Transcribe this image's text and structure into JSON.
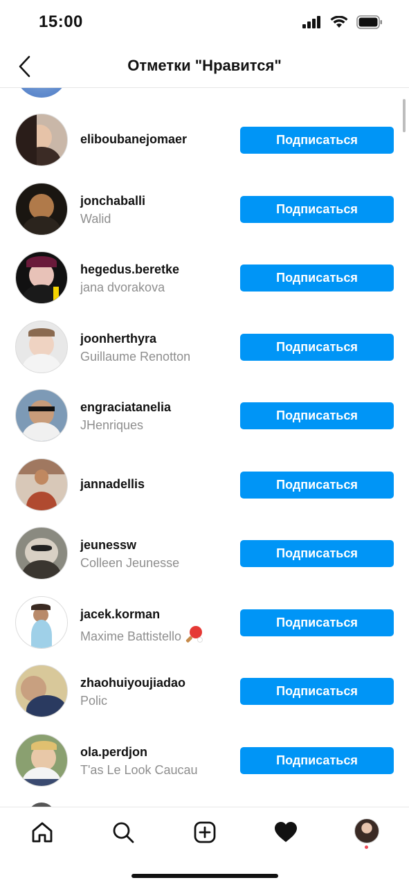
{
  "status_bar": {
    "time": "15:00"
  },
  "header": {
    "title": "Отметки \"Нравится\""
  },
  "users": [
    {
      "username": "eliboubanejomaer",
      "full_name": "",
      "button": "Подписаться"
    },
    {
      "username": "jonchaballi",
      "full_name": "Walid",
      "button": "Подписаться"
    },
    {
      "username": "hegedus.beretke",
      "full_name": "jana dvorakova",
      "button": "Подписаться"
    },
    {
      "username": "joonherthyra",
      "full_name": "Guillaume Renotton",
      "button": "Подписаться"
    },
    {
      "username": "engraciatanelia",
      "full_name": "JHenriques",
      "button": "Подписаться"
    },
    {
      "username": "jannadellis",
      "full_name": "",
      "button": "Подписаться"
    },
    {
      "username": "jeunessw",
      "full_name": "Colleen Jeunesse",
      "button": "Подписаться"
    },
    {
      "username": "jacek.korman",
      "full_name": "Maxime Battistello",
      "emoji": "🏓",
      "button": "Подписаться"
    },
    {
      "username": "zhaohuiyoujiadao",
      "full_name": "Polic",
      "button": "Подписаться"
    },
    {
      "username": "ola.perdjon",
      "full_name": "T'as Le Look Caucau",
      "button": "Подписаться"
    }
  ],
  "tab_bar": {
    "tabs": [
      {
        "name": "home-icon"
      },
      {
        "name": "search-icon"
      },
      {
        "name": "new-post-icon"
      },
      {
        "name": "activity-heart-icon"
      },
      {
        "name": "profile-avatar"
      }
    ]
  },
  "colors": {
    "accent": "#0095f6",
    "secondary_text": "#8e8e8e",
    "notification": "#ed4956"
  }
}
